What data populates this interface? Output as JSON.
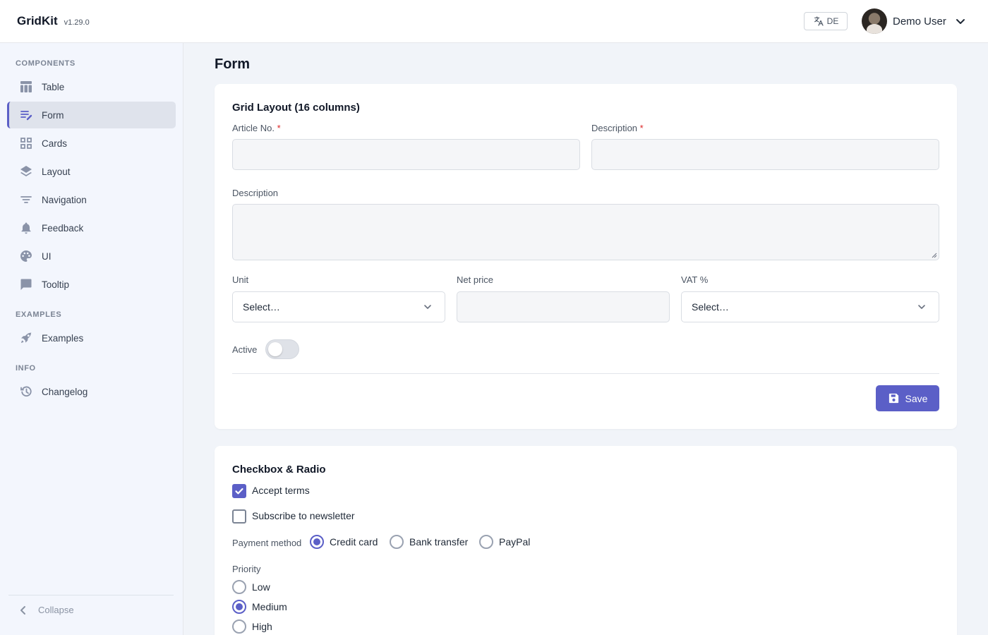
{
  "app": {
    "name": "GridKit",
    "version": "v1.29.0"
  },
  "header": {
    "language_label": "DE",
    "user_name": "Demo User"
  },
  "sidebar": {
    "sections": [
      {
        "title": "COMPONENTS"
      },
      {
        "title": "EXAMPLES"
      },
      {
        "title": "INFO"
      }
    ],
    "items": [
      {
        "label": "Table",
        "icon": "table-icon"
      },
      {
        "label": "Form",
        "icon": "form-edit-icon",
        "active": true
      },
      {
        "label": "Cards",
        "icon": "grid-icon"
      },
      {
        "label": "Layout",
        "icon": "layers-icon"
      },
      {
        "label": "Navigation",
        "icon": "filter-lines-icon"
      },
      {
        "label": "Feedback",
        "icon": "bell-icon"
      },
      {
        "label": "UI",
        "icon": "palette-icon"
      },
      {
        "label": "Tooltip",
        "icon": "chat-bubble-icon"
      },
      {
        "label": "Examples",
        "icon": "rocket-icon"
      },
      {
        "label": "Changelog",
        "icon": "history-icon"
      }
    ],
    "collapse_label": "Collapse"
  },
  "page": {
    "title": "Form"
  },
  "grid_form": {
    "title": "Grid Layout (16 columns)",
    "article_no": {
      "label": "Article No.",
      "required": "*",
      "value": ""
    },
    "description_short": {
      "label": "Description",
      "required": "*",
      "value": ""
    },
    "description_long": {
      "label": "Description",
      "value": ""
    },
    "unit": {
      "label": "Unit",
      "selected": "Select…"
    },
    "net_price": {
      "label": "Net price",
      "value": ""
    },
    "vat": {
      "label": "VAT %",
      "selected": "Select…"
    },
    "active": {
      "label": "Active",
      "on": false
    },
    "save_label": "Save"
  },
  "choices": {
    "title": "Checkbox & Radio",
    "accept_terms": {
      "label": "Accept terms",
      "checked": true
    },
    "newsletter": {
      "label": "Subscribe to newsletter",
      "checked": false
    },
    "payment": {
      "label": "Payment method",
      "options": [
        "Credit card",
        "Bank transfer",
        "PayPal"
      ],
      "selected": "Credit card"
    },
    "priority": {
      "label": "Priority",
      "options": [
        "Low",
        "Medium",
        "High"
      ],
      "selected": "Medium"
    }
  },
  "colors": {
    "accent": "#5b5fc7",
    "required": "#dc2626",
    "sidebar_bg": "#f3f6fd",
    "page_bg": "#f1f4f9"
  }
}
